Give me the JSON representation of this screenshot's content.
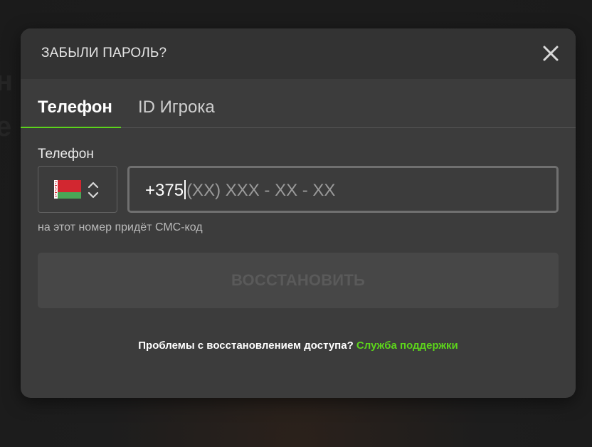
{
  "background": {
    "ghost_text": "н\nе"
  },
  "modal": {
    "title": "ЗАБЫЛИ ПАРОЛЬ?",
    "close_icon": "close-icon",
    "tabs": [
      {
        "label": "Телефон",
        "active": true
      },
      {
        "label": "ID Игрока",
        "active": false
      }
    ],
    "phone_field": {
      "label": "Телефон",
      "country": {
        "flag": "belarus-flag-icon",
        "chevrons_icon": "chevron-up-down-icon"
      },
      "prefix": "+375",
      "mask": "(XX) XXX - XX - XX",
      "hint": "на этот номер придёт СМС-код"
    },
    "submit_button": {
      "label": "ВОССТАНОВИТЬ",
      "disabled": true
    },
    "footer": {
      "question": "Проблемы с восстановлением доступа?",
      "support_link": "Служба поддержки"
    }
  },
  "colors": {
    "accent": "#5cd41b",
    "modal_bg": "#3c3c3c",
    "header_bg": "#333333",
    "button_disabled_bg": "#474747",
    "flag_red": "#d22730",
    "flag_green": "#4aa657"
  }
}
